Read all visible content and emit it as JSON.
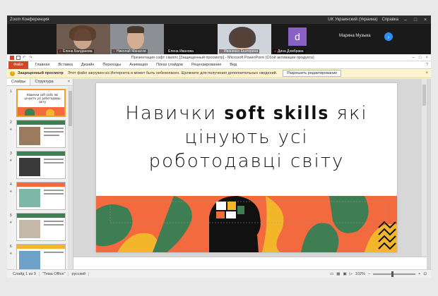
{
  "zoom": {
    "app_title": "Zoom Конференция",
    "language_label": "UK Украинский (Украина)",
    "help_label": "Справка"
  },
  "participants": [
    {
      "name": "Елена Балданова"
    },
    {
      "name": "Николай Манасов"
    },
    {
      "name": "Елена Иванова"
    },
    {
      "name": "Иваненко Екатерина"
    },
    {
      "name": "Дина Домбрава",
      "initial": "d"
    },
    {
      "name": "Марина Музыка"
    }
  ],
  "powerpoint": {
    "window_title": "Презентация софт скиллс [Защищенный просмотр] - Microsoft PowerPoint (Сбой активации продукта)",
    "tabs": [
      "Файл",
      "Главная",
      "Вставка",
      "Дизайн",
      "Переходы",
      "Анимация",
      "Показ слайдов",
      "Рецензирование",
      "Вид"
    ],
    "message_bar": {
      "title": "Защищенный просмотр",
      "text": "Этот файл загружен из Интернета и может быть небезопасен. Щелкните для получения дополнительных сведений.",
      "button": "Разрешить редактирование"
    },
    "panel_tabs": [
      "Слайды",
      "Структура"
    ],
    "thumbnails": [
      {
        "num": "1",
        "title": "Навички soft skills які цінують усі роботодавці світу",
        "selected": true
      },
      {
        "num": "2"
      },
      {
        "num": "3"
      },
      {
        "num": "4"
      },
      {
        "num": "5"
      },
      {
        "num": "6"
      }
    ],
    "slide": {
      "title_line1_pre": "Навички ",
      "title_line1_bold": "soft skills",
      "title_line1_post": " які цінують усі",
      "title_line2": "роботодавці світу"
    },
    "status": {
      "slide_info": "Слайд 1 из 9",
      "theme": "\"Тема Office\"",
      "language": "русский",
      "zoom": "102%"
    },
    "colors": {
      "file_tab": "#d24726",
      "message_bar": "#fff4ce",
      "slide_orange": "#f26a3d",
      "slide_green": "#3f7d52",
      "slide_yellow": "#f3b62b"
    }
  }
}
